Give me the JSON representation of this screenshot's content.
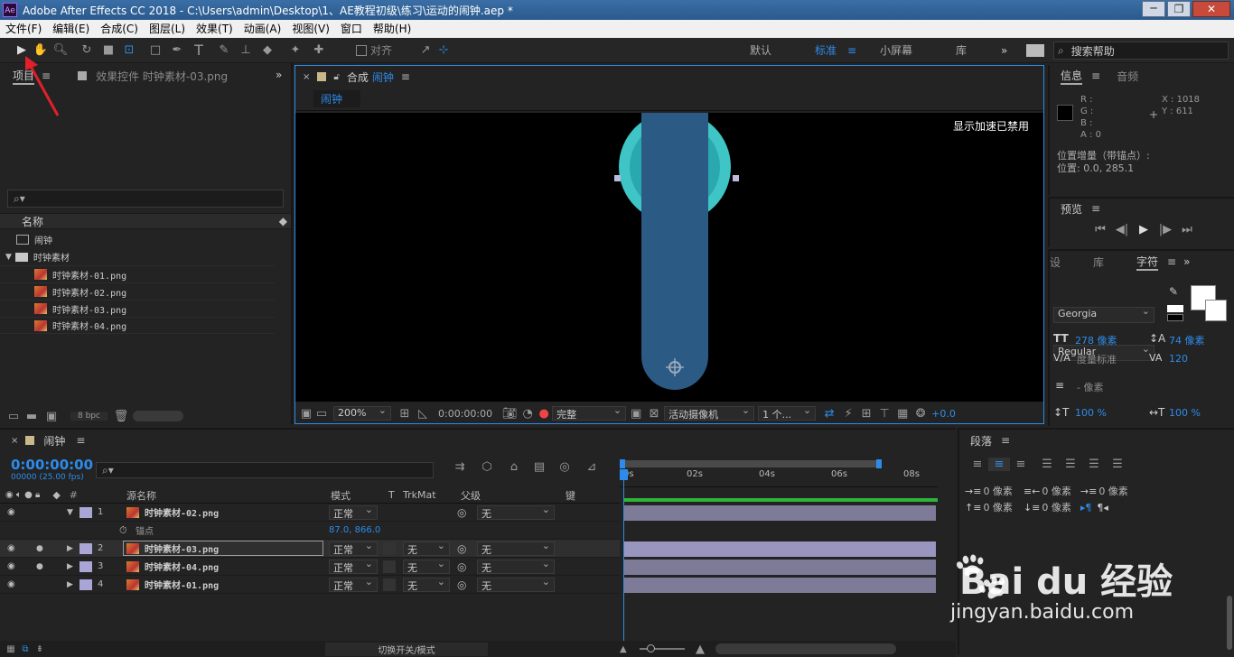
{
  "window": {
    "title": "Adobe After Effects CC 2018 - C:\\Users\\admin\\Desktop\\1、AE教程初级\\练习\\运动的闹钟.aep *",
    "app_badge": "Ae"
  },
  "menu": [
    "文件(F)",
    "编辑(E)",
    "合成(C)",
    "图层(L)",
    "效果(T)",
    "动画(A)",
    "视图(V)",
    "窗口",
    "帮助(H)"
  ],
  "toolbar": {
    "align_label": "对齐",
    "workspaces": [
      "默认",
      "标准",
      "小屏幕",
      "库"
    ],
    "active_workspace": "标准",
    "search_placeholder": "搜索帮助"
  },
  "project": {
    "tab_project": "项目",
    "tab_effects": "效果控件 时钟素材-03.png",
    "col_name": "名称",
    "items": [
      {
        "name": "闹钟",
        "type": "comp"
      },
      {
        "name": "时钟素材",
        "type": "folder"
      },
      {
        "name": "时钟素材-01.png",
        "type": "file"
      },
      {
        "name": "时钟素材-02.png",
        "type": "file"
      },
      {
        "name": "时钟素材-03.png",
        "type": "file"
      },
      {
        "name": "时钟素材-04.png",
        "type": "file"
      }
    ],
    "bpc": "8 bpc"
  },
  "comp_viewer": {
    "tab_prefix": "合成",
    "tab_name": "闹钟",
    "breadcrumb": "闹钟",
    "notice": "显示加速已禁用",
    "zoom": "200%",
    "timecode": "0:00:00:00",
    "quality": "完整",
    "camera": "活动摄像机",
    "views": "1 个...",
    "exposure": "+0.0"
  },
  "info": {
    "tab_info": "信息",
    "tab_audio": "音频",
    "r": "R :",
    "g": "G :",
    "b": "B :",
    "a": "A : 0",
    "x": "X : 1018",
    "y": "Y : 611",
    "line1": "位置增量（带锚点）:",
    "line2": "位置: 0.0, 285.1"
  },
  "preview": {
    "title": "预览"
  },
  "character": {
    "tab_set": "设",
    "tab_lib": "库",
    "tab_char": "字符",
    "font": "Georgia",
    "style": "Regular",
    "size": "278 像素",
    "leading": "74 像素",
    "kerning": "度量标准",
    "tracking": "120",
    "stroke": "- 像素",
    "vscale": "100 %",
    "hscale": "100 %"
  },
  "paragraph": {
    "title": "段落",
    "indent_left": "0 像素",
    "indent_right": "0 像素",
    "indent_first": "0 像素",
    "space_before": "0 像素",
    "space_after": "0 像素"
  },
  "timeline": {
    "comp_name": "闹钟",
    "timecode": "0:00:00:00",
    "fps": "00000 (25.00 fps)",
    "cols": {
      "source": "源名称",
      "mode": "模式",
      "t": "T",
      "trkmat": "TrkMat",
      "parent": "父级",
      "keys": "键"
    },
    "ruler": [
      "0s",
      "02s",
      "04s",
      "06s",
      "08s"
    ],
    "layers": [
      {
        "num": "1",
        "name": "时钟素材-02.png",
        "mode": "正常",
        "trkmat": "",
        "parent": "无",
        "expanded": true
      },
      {
        "num": "2",
        "name": "时钟素材-03.png",
        "mode": "正常",
        "trkmat": "无",
        "parent": "无",
        "selected": true
      },
      {
        "num": "3",
        "name": "时钟素材-04.png",
        "mode": "正常",
        "trkmat": "无",
        "parent": "无"
      },
      {
        "num": "4",
        "name": "时钟素材-01.png",
        "mode": "正常",
        "trkmat": "无",
        "parent": "无"
      }
    ],
    "anchor_label": "锚点",
    "anchor_value": "87.0, 866.0",
    "footer": "切换开关/模式"
  },
  "watermark": {
    "brand": "Bai du 经验",
    "url": "jingyan.baidu.com"
  },
  "colors": {
    "accent": "#2d8ceb",
    "teal": "#3fc5c5",
    "hand": "#2b5a84",
    "track": "#7d7b98"
  }
}
